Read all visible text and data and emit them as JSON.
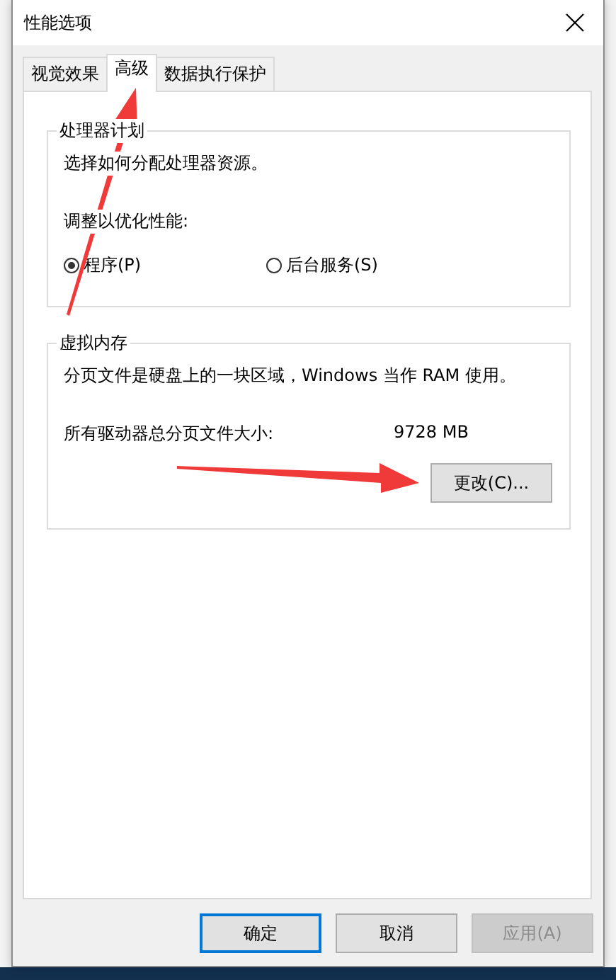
{
  "window": {
    "title": "性能选项"
  },
  "tabs": [
    {
      "label": "视觉效果",
      "selected": false
    },
    {
      "label": "高级",
      "selected": true
    },
    {
      "label": "数据执行保护",
      "selected": false
    }
  ],
  "processor_scheduling": {
    "title": "处理器计划",
    "description": "选择如何分配处理器资源。",
    "adjust_label": "调整以优化性能:",
    "options": [
      {
        "label": "程序(P)",
        "selected": true
      },
      {
        "label": "后台服务(S)",
        "selected": false
      }
    ]
  },
  "virtual_memory": {
    "title": "虚拟内存",
    "description": "分页文件是硬盘上的一块区域，Windows 当作 RAM 使用。",
    "total_label": "所有驱动器总分页文件大小:",
    "total_value": "9728 MB",
    "change_button": "更改(C)..."
  },
  "buttons": [
    {
      "label": "确定",
      "kind": "default",
      "disabled": false
    },
    {
      "label": "取消",
      "kind": "normal",
      "disabled": false
    },
    {
      "label": "应用(A)",
      "kind": "normal",
      "disabled": true
    }
  ]
}
